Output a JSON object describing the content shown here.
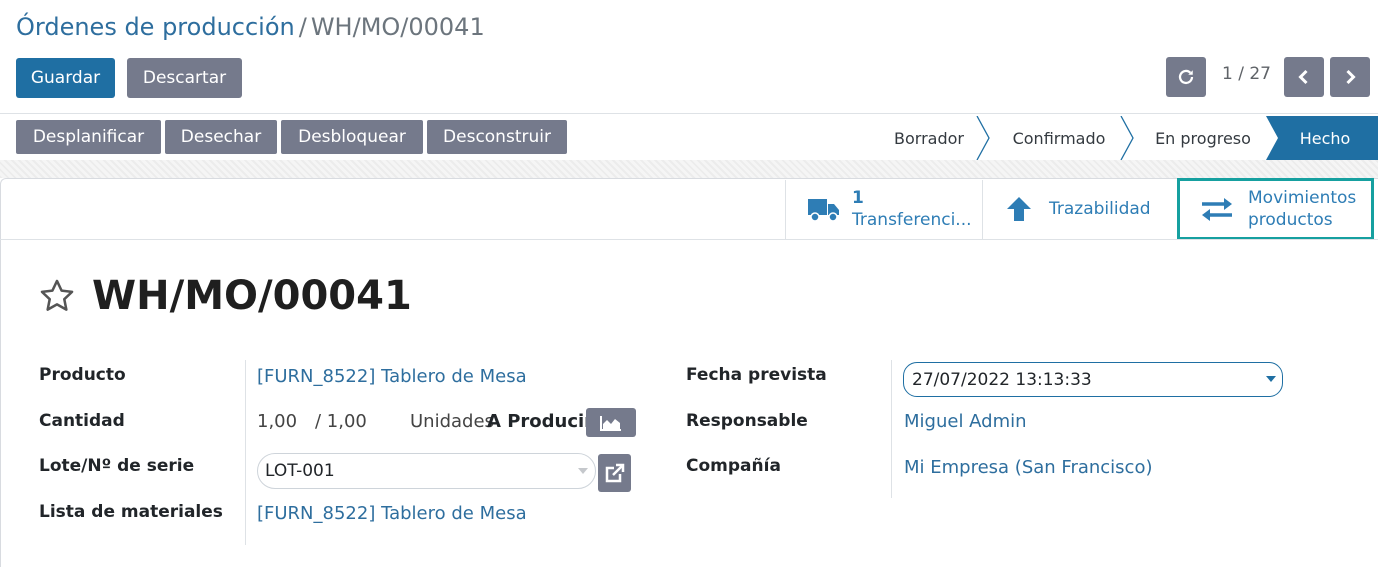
{
  "breadcrumb": {
    "parent": "Órdenes de producción",
    "separator": "/",
    "current": "WH/MO/00041"
  },
  "toolbar": {
    "save_label": "Guardar",
    "discard_label": "Descartar",
    "pager": "1 / 27"
  },
  "actions": {
    "unplan": "Desplanificar",
    "scrap": "Desechar",
    "unlock": "Desbloquear",
    "unbuild": "Desconstruir"
  },
  "status": {
    "steps": [
      "Borrador",
      "Confirmado",
      "En progreso",
      "Hecho"
    ],
    "active": "Hecho"
  },
  "smart_buttons": {
    "transfers_count": "1",
    "transfers_label": "Transferenci...",
    "traceability_label": "Trazabilidad",
    "moves_line1": "Movimientos",
    "moves_line2": "productos"
  },
  "record": {
    "title": "WH/MO/00041"
  },
  "form": {
    "product_label": "Producto",
    "product_value": "[FURN_8522] Tablero de Mesa",
    "quantity_label": "Cantidad",
    "quantity_done": "1,00",
    "quantity_total": "/ 1,00",
    "uom": "Unidades",
    "to_produce": "A Producir",
    "lot_label": "Lote/Nº de serie",
    "lot_value": "LOT-001",
    "bom_label": "Lista de materiales",
    "bom_value": "[FURN_8522] Tablero de Mesa",
    "date_label": "Fecha prevista",
    "date_value": "27/07/2022 13:13:33",
    "responsible_label": "Responsable",
    "responsible_value": "Miguel Admin",
    "company_label": "Compañía",
    "company_value": "Mi Empresa (San Francisco)"
  },
  "colors": {
    "primary": "#1f6fa3",
    "secondary": "#757a8c",
    "link": "#2e6e9e",
    "highlight": "#16a0a0"
  }
}
